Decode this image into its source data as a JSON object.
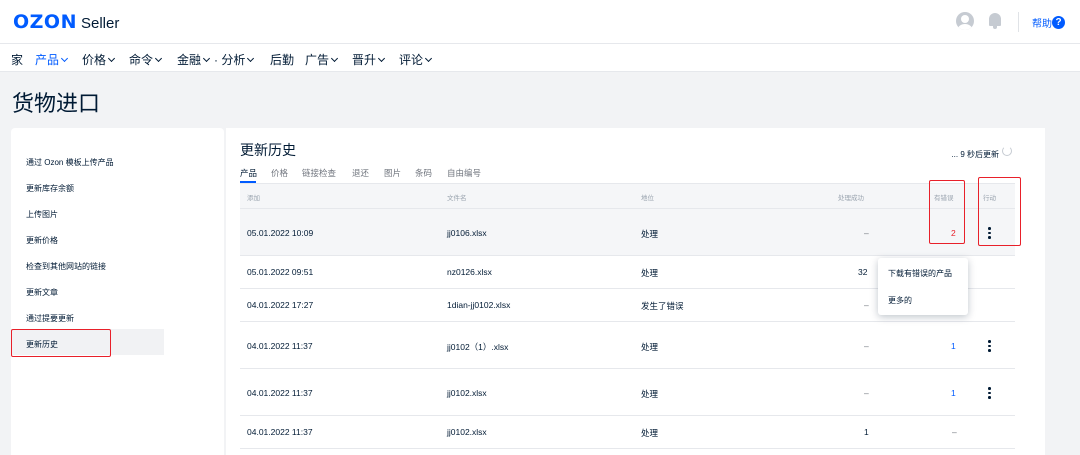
{
  "header": {
    "logo_brand": "OZON",
    "logo_product": "Seller",
    "help_label": "帮助",
    "help_icon_glyph": "?"
  },
  "nav": {
    "items": [
      {
        "label": "家",
        "has_dropdown": false,
        "active": false
      },
      {
        "label": "产品",
        "has_dropdown": true,
        "active": true
      },
      {
        "label": "价格",
        "has_dropdown": true,
        "active": false
      },
      {
        "label": "命令",
        "has_dropdown": true,
        "active": false
      },
      {
        "label": "金融",
        "has_dropdown": true,
        "active": false
      },
      {
        "label": "· 分析",
        "has_dropdown": true,
        "active": false
      },
      {
        "label": "后勤",
        "has_dropdown": false,
        "active": false
      },
      {
        "label": "广告",
        "has_dropdown": true,
        "active": false
      },
      {
        "label": "晋升",
        "has_dropdown": true,
        "active": false
      },
      {
        "label": "评论",
        "has_dropdown": true,
        "active": false
      }
    ]
  },
  "page_title": "货物进口",
  "sidebar": {
    "items": [
      {
        "label": "通过 Ozon 模板上传产品"
      },
      {
        "label": "更新库存余额"
      },
      {
        "label": "上传图片"
      },
      {
        "label": "更新价格"
      },
      {
        "label": "检查到其他网站的链接"
      },
      {
        "label": "更新文章"
      },
      {
        "label": "通过提要更新"
      },
      {
        "label": "更新历史",
        "active": true
      }
    ]
  },
  "main": {
    "title": "更新历史",
    "refresh_text": "... 9 秒后更新",
    "tabs": [
      "产品",
      "价格",
      "链接检查",
      "退还",
      "图片",
      "条码",
      "自由编号"
    ],
    "table": {
      "headers": [
        "添加",
        "文件名",
        "地位",
        "处理成功",
        "有错误",
        "行动"
      ],
      "rows": [
        {
          "date": "05.01.2022 10:09",
          "file": "jj0106.xlsx",
          "status": "处理",
          "success": "–",
          "errors": "2",
          "action": "more-icon"
        },
        {
          "date": "05.01.2022 09:51",
          "file": "nz0126.xlsx",
          "status": "处理",
          "success": "32",
          "errors": "",
          "action": ""
        },
        {
          "date": "04.01.2022 17:27",
          "file": "1dian-jj0102.xlsx",
          "status": "发生了错误",
          "success": "–",
          "errors": "",
          "action": ""
        },
        {
          "date": "04.01.2022 11:37",
          "file": "jj0102（1）.xlsx",
          "status": "处理",
          "success": "–",
          "errors": "1",
          "action": "more-icon"
        },
        {
          "date": "04.01.2022 11:37",
          "file": "jj0102.xlsx",
          "status": "处理",
          "success": "–",
          "errors": "1",
          "action": "more-icon"
        },
        {
          "date": "04.01.2022 11:37",
          "file": "jj0102.xlsx",
          "status": "处理",
          "success": "1",
          "errors": "–",
          "action": ""
        }
      ]
    },
    "context_menu": {
      "items": [
        "下载有错误的产品",
        "更多的"
      ]
    }
  },
  "colors": {
    "brand_blue": "#005bff",
    "error_red": "#e8202a",
    "highlight_red_box": "#e8202a"
  }
}
